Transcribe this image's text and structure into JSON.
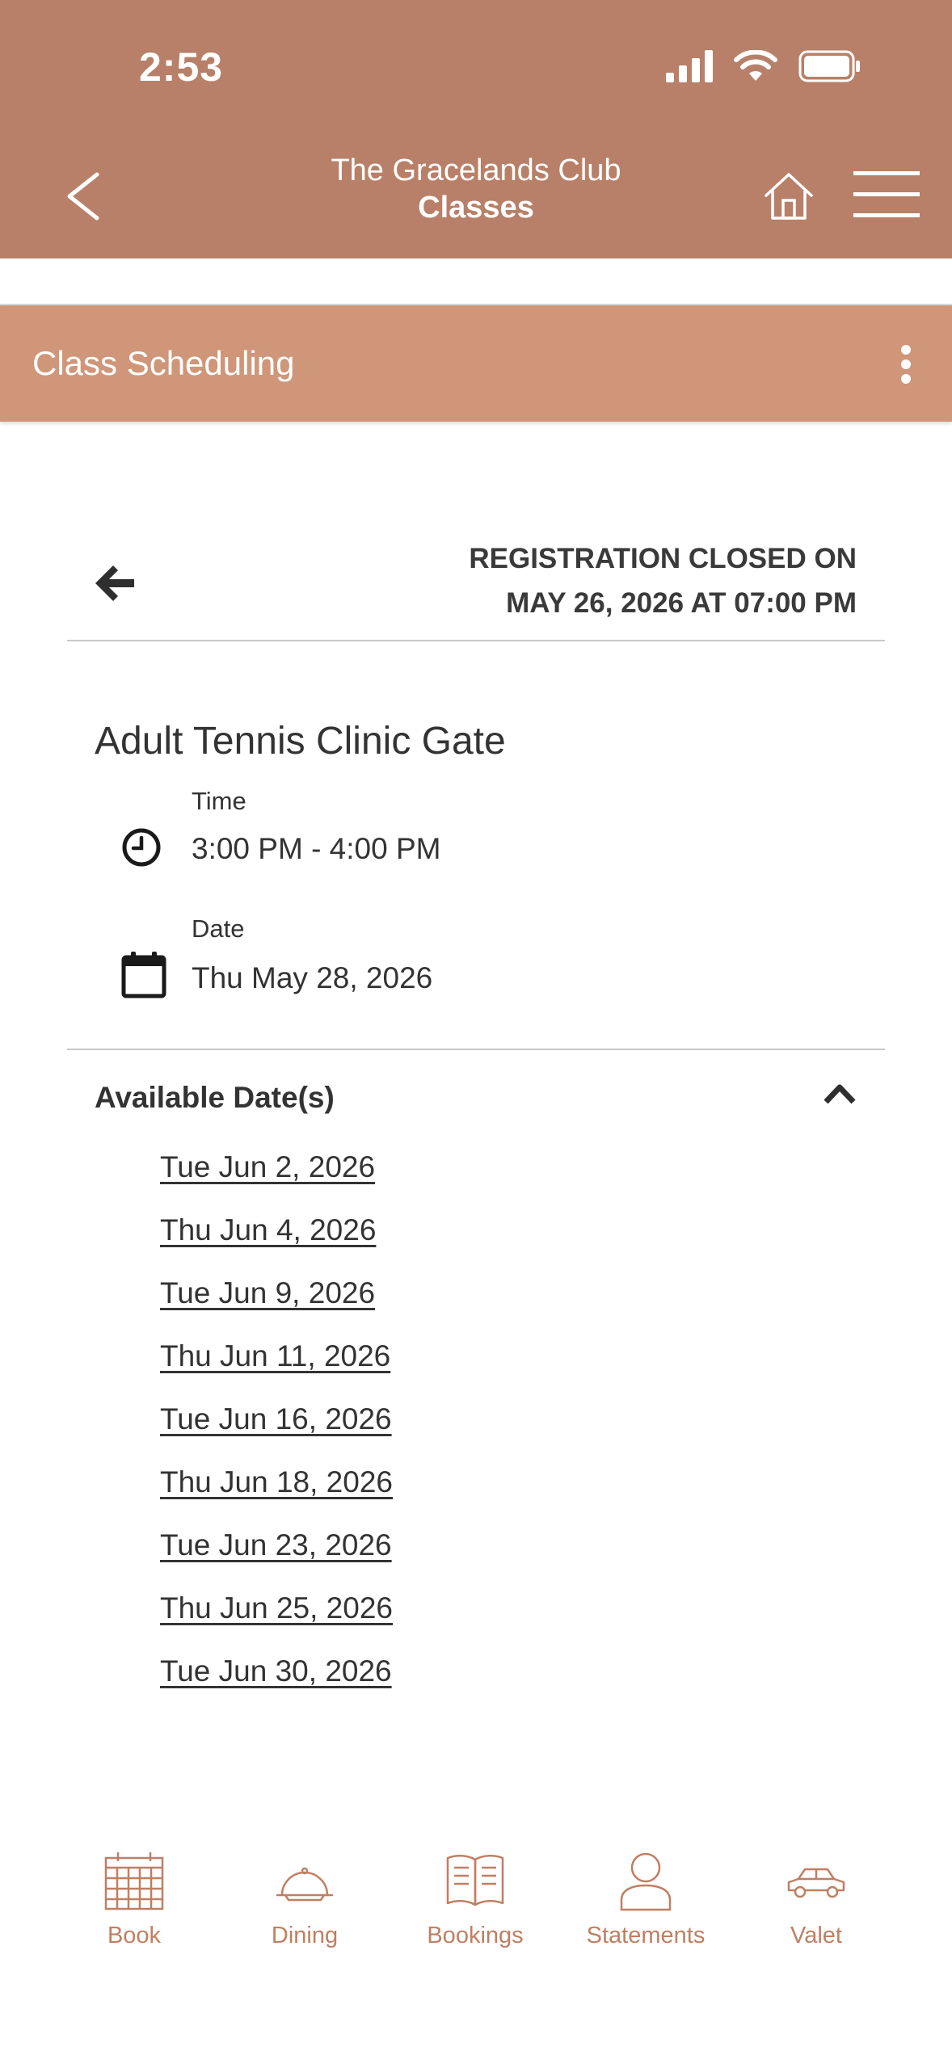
{
  "status_bar": {
    "time": "2:53"
  },
  "header": {
    "title": "The Gracelands Club",
    "subtitle": "Classes"
  },
  "section": {
    "title": "Class Scheduling"
  },
  "registration": {
    "line1": "REGISTRATION CLOSED ON",
    "line2": "MAY 26, 2026 AT 07:00 PM"
  },
  "class": {
    "name": "Adult Tennis Clinic Gate",
    "time_label": "Time",
    "time_value": "3:00 PM - 4:00 PM",
    "date_label": "Date",
    "date_value": "Thu May 28, 2026"
  },
  "available": {
    "title": "Available Date(s)",
    "dates": [
      "Tue Jun 2, 2026",
      "Thu Jun 4, 2026",
      "Tue Jun 9, 2026",
      "Thu Jun 11, 2026",
      "Tue Jun 16, 2026",
      "Thu Jun 18, 2026",
      "Tue Jun 23, 2026",
      "Thu Jun 25, 2026",
      "Tue Jun 30, 2026"
    ]
  },
  "bottom_nav": {
    "items": [
      {
        "label": "Book",
        "icon": "calendar-grid-icon"
      },
      {
        "label": "Dining",
        "icon": "cloche-icon"
      },
      {
        "label": "Bookings",
        "icon": "open-book-icon"
      },
      {
        "label": "Statements",
        "icon": "person-icon"
      },
      {
        "label": "Valet",
        "icon": "car-icon"
      }
    ]
  },
  "colors": {
    "header_bg": "#b88068",
    "section_bg": "#cf9679",
    "nav_accent": "#c07f62"
  }
}
